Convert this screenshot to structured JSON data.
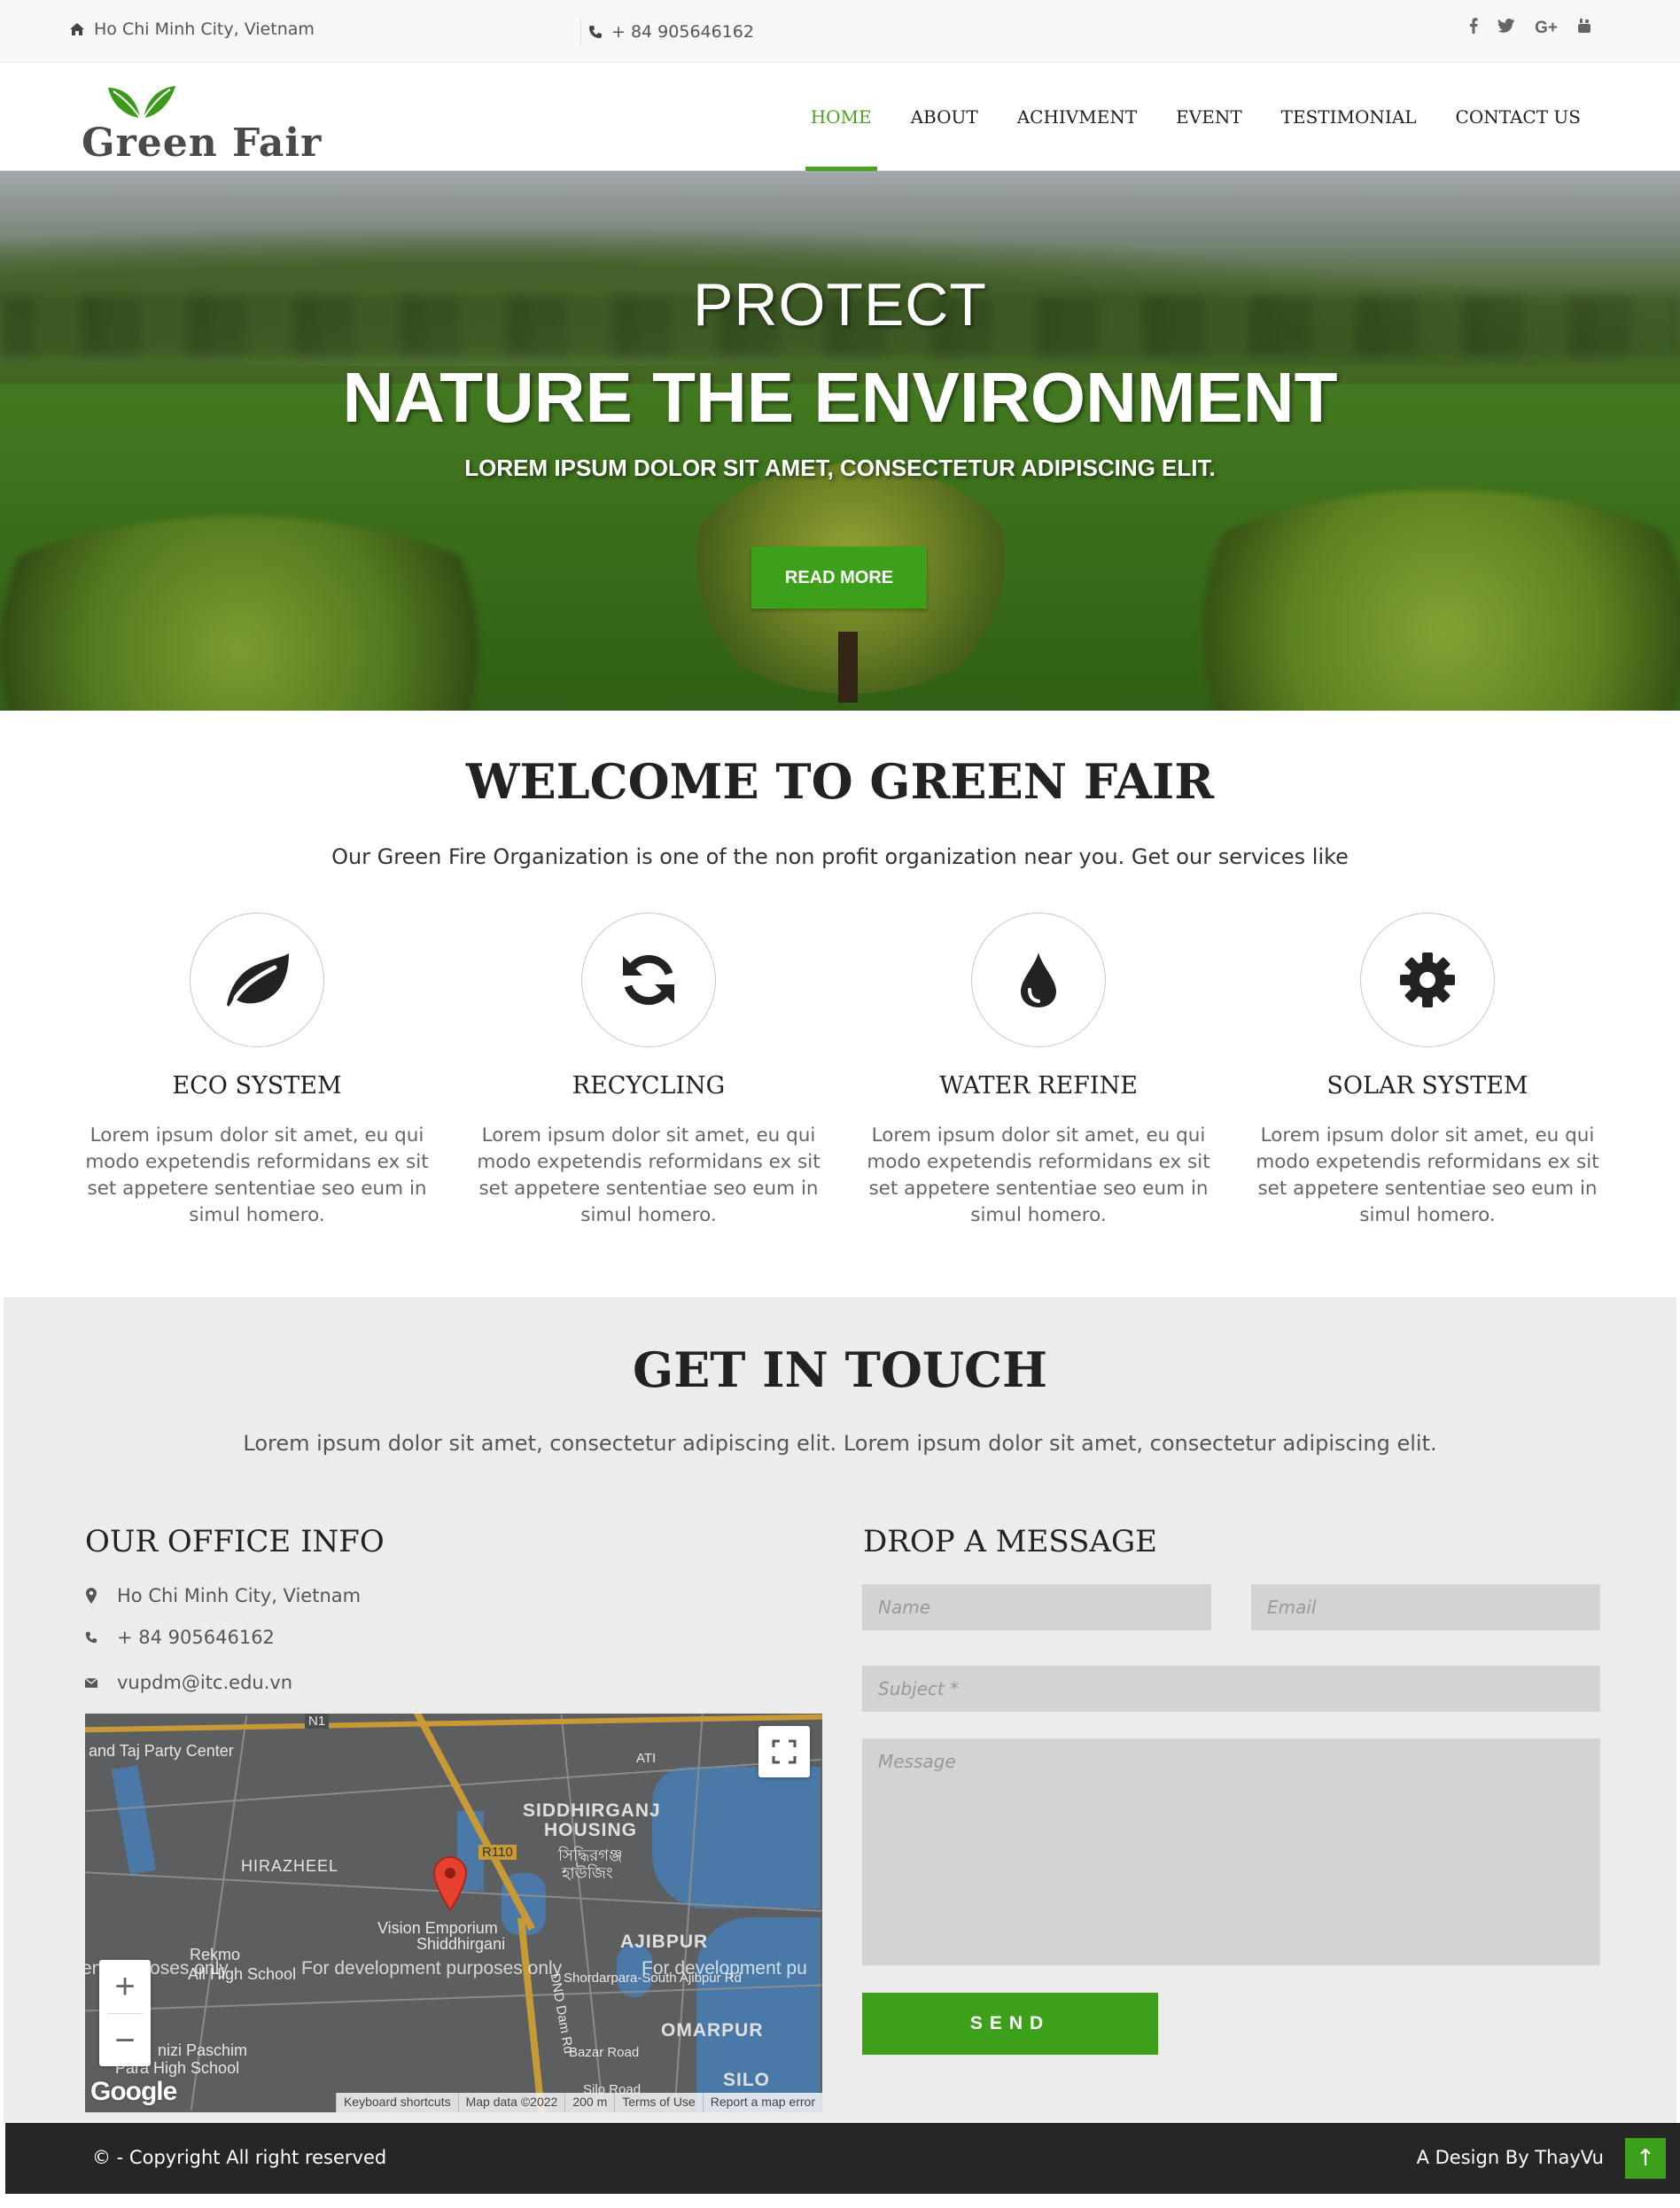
{
  "topbar": {
    "address": "Ho Chi Minh City, Vietnam",
    "phone": "+ 84 905646162",
    "social": [
      "f",
      "t",
      "G+",
      "yt"
    ]
  },
  "header": {
    "logo_text": "Green Fair",
    "nav": [
      {
        "label": "HOME",
        "active": true
      },
      {
        "label": "ABOUT",
        "active": false
      },
      {
        "label": "ACHIVMENT",
        "active": false
      },
      {
        "label": "EVENT",
        "active": false
      },
      {
        "label": "TESTIMONIAL",
        "active": false
      },
      {
        "label": "CONTACT US",
        "active": false
      }
    ]
  },
  "hero": {
    "title_small": "PROTECT",
    "title_big": "NATURE THE ENVIRONMENT",
    "subtitle": "LOREM IPSUM DOLOR SIT AMET, CONSECTETUR ADIPISCING ELIT.",
    "button": "READ MORE"
  },
  "welcome": {
    "title": "WELCOME TO GREEN FAIR",
    "description": "Our Green Fire Organization is one of the non profit organization near you. Get our services like",
    "services": [
      {
        "title": "ECO SYSTEM",
        "icon": "leaf-icon",
        "text": "Lorem ipsum dolor sit amet, eu qui modo expetendis reformidans ex sit set appetere sententiae seo eum in simul homero."
      },
      {
        "title": "RECYCLING",
        "icon": "refresh-icon",
        "text": "Lorem ipsum dolor sit amet, eu qui modo expetendis reformidans ex sit set appetere sententiae seo eum in simul homero."
      },
      {
        "title": "WATER REFINE",
        "icon": "water-drop-icon",
        "text": "Lorem ipsum dolor sit amet, eu qui modo expetendis reformidans ex sit set appetere sententiae seo eum in simul homero."
      },
      {
        "title": "SOLAR SYSTEM",
        "icon": "gear-icon",
        "text": "Lorem ipsum dolor sit amet, eu qui modo expetendis reformidans ex sit set appetere sententiae seo eum in simul homero."
      }
    ]
  },
  "contact": {
    "title": "GET IN TOUCH",
    "description": "Lorem ipsum dolor sit amet, consectetur adipiscing elit. Lorem ipsum dolor sit amet, consectetur adipiscing elit.",
    "office_title": "OUR OFFICE INFO",
    "address": "Ho Chi Minh City, Vietnam",
    "phone": "+ 84 905646162",
    "email": "vupdm@itc.edu.vn",
    "message_title": "DROP A MESSAGE",
    "form": {
      "name_placeholder": "Name",
      "email_placeholder": "Email",
      "subject_placeholder": "Subject *",
      "message_placeholder": "Message",
      "send_label": "SEND"
    },
    "map": {
      "labels": {
        "party_center": "and Taj Party Center",
        "siddhirganj_1": "SIDDHIRGANJ",
        "siddhirganj_2": "HOUSING",
        "siddhirganj_bn": "সিদ্ধিরগঞ্জ",
        "siddhirganj_bn2": "হাউজিং",
        "hirazheel": "HIRAZHEEL",
        "vision": "Vision Emporium",
        "vision2": "Shiddhirgani",
        "ajibpur": "AJIBPUR",
        "omarpur": "OMARPUR",
        "silo": "SILO",
        "all_high": "All High School",
        "rekmo": "Rekmo",
        "paschim": "nizi Paschim",
        "para_high": "Para High School",
        "shordarpara": "Shordarpara-South Ajibpur Rd",
        "bazar": "Bazar Road",
        "silo_road": "Silo Road",
        "dnd": "DND Dam Rd",
        "r110": "R110",
        "n1": "N1",
        "ati": "ATI"
      },
      "dev_notice": [
        "ent purposes only",
        "For development purposes only",
        "For development pu"
      ],
      "attribution": [
        "Keyboard shortcuts",
        "Map data ©2022",
        "200 m",
        "Terms of Use",
        "Report a map error"
      ],
      "google": "Google"
    }
  },
  "footer": {
    "copyright": "© - Copyright  All right reserved",
    "design": "A Design By  ThayVu",
    "to_top": "↑"
  },
  "colors": {
    "accent": "#3ca01a",
    "footer_bg": "#262626",
    "contact_bg": "#ececec"
  }
}
